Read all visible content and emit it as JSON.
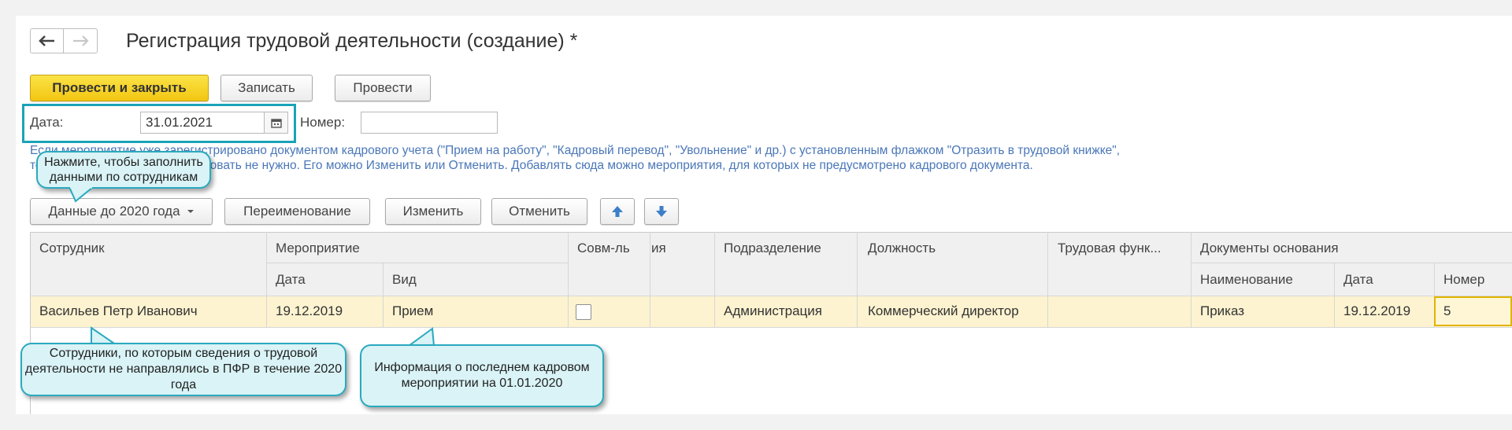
{
  "window": {
    "title": "Регистрация трудовой деятельности (создание) *"
  },
  "toolbar": {
    "post_close_label": "Провести и закрыть",
    "save_label": "Записать",
    "post_label": "Провести"
  },
  "form": {
    "date_label": "Дата:",
    "date_value": "31.01.2021",
    "number_label": "Номер:",
    "number_value": ""
  },
  "info_text": "Если мероприятие уже зарегистрировано документом кадрового учета (\"Прием на работу\", \"Кадровый перевод\", \"Увольнение\" и др.) с установленным флажком \"Отразить в трудовой книжке\", то в этом документе его дублировать не нужно. Его можно Изменить или Отменить. Добавлять сюда можно мероприятия, для которых не предусмотрено кадрового документа.",
  "table_toolbar": {
    "data_2020_label": "Данные до 2020 года",
    "rename_label": "Переименование",
    "change_label": "Изменить",
    "cancel_label": "Отменить"
  },
  "table": {
    "headers": {
      "employee": "Сотрудник",
      "event": "Мероприятие",
      "event_date": "Дата",
      "event_kind": "Вид",
      "combination": "Совм-ль",
      "partial": "ия",
      "department": "Подразделение",
      "position": "Должность",
      "labor_function": "Трудовая функ...",
      "basis_docs": "Документы основания",
      "doc_name": "Наименование",
      "doc_date": "Дата",
      "doc_number": "Номер"
    },
    "rows": [
      {
        "employee": "Васильев Петр Иванович",
        "date": "19.12.2019",
        "kind": "Прием",
        "combination": false,
        "department": "Администрация",
        "position": "Коммерческий директор",
        "labor_function": "",
        "doc_name": "Приказ",
        "doc_date": "19.12.2019",
        "doc_number": "5"
      }
    ]
  },
  "callouts": {
    "fill_hint": "Нажмите, чтобы заполнить данными по сотрудникам",
    "employees_hint": "Сотрудники, по которым сведения о трудовой деятельности не направлялись в ПФР в течение 2020 года",
    "last_event_hint": "Информация о последнем кадровом мероприятии на 01.01.2020"
  },
  "colors": {
    "accent": "#1aa3b8",
    "primary_button": "#f5cf1d",
    "selected_row": "#fdf3d0",
    "info_text": "#4a77b8"
  }
}
